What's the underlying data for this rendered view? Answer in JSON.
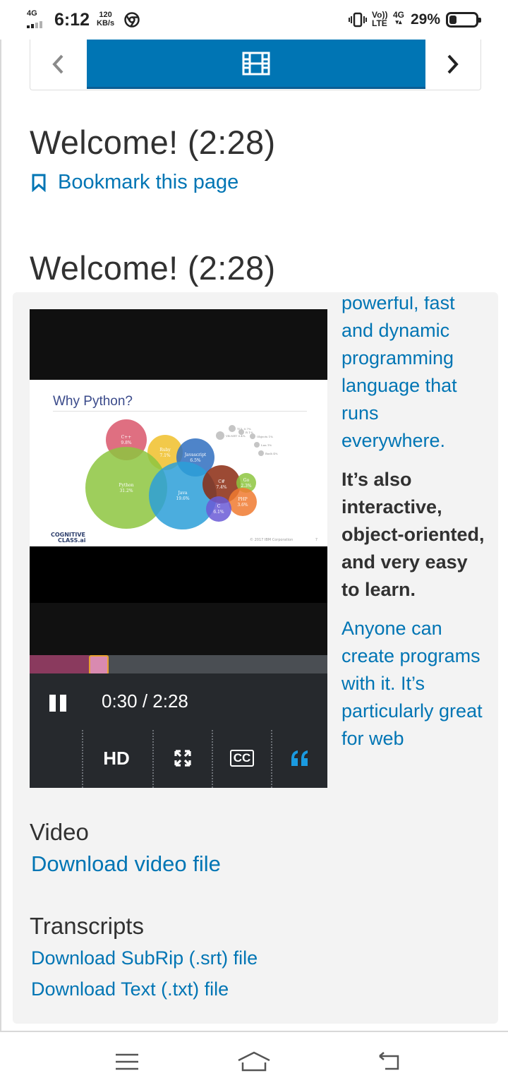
{
  "status_bar": {
    "network_badge": "4G",
    "time": "6:12",
    "speed_value": "120",
    "speed_unit": "KB/s",
    "volte_top": "Vo))",
    "volte_bottom": "LTE",
    "net_type": "4G",
    "battery_percent": "29%",
    "battery_level": 0.29
  },
  "sequence_nav": {
    "active_icon": "film-icon",
    "accent_color": "#0075b4"
  },
  "unit": {
    "header_title": "Welcome! (2:28)",
    "bookmark_label": "Bookmark this page",
    "video_title": "Welcome! (2:28)"
  },
  "video": {
    "slide_title": "Why Python?",
    "slide_logo_line1": "COGNITIVE",
    "slide_logo_line2": "CLASS.ai",
    "slide_copyright": "© 2017 IBM Corporation",
    "slide_page": "7",
    "bubbles": [
      {
        "label": "C++",
        "value": "9.8%",
        "color": "#d9566b"
      },
      {
        "label": "Ruby",
        "value": "7.1%",
        "color": "#f0c02a"
      },
      {
        "label": "Javascript",
        "value": "6.5%",
        "color": "#2f6fbf"
      },
      {
        "label": "Python",
        "value": "31.2%",
        "color": "#8dc63f"
      },
      {
        "label": "Java",
        "value": "19.6%",
        "color": "#2b9fd8"
      },
      {
        "label": "C#",
        "value": "7.4%",
        "color": "#8b2a10"
      },
      {
        "label": "Go",
        "value": "2.3%",
        "color": "#8dc63f"
      },
      {
        "label": "PHP",
        "value": "3.6%",
        "color": "#f07a30"
      },
      {
        "label": "C",
        "value": "6.1%",
        "color": "#6a5bd6"
      },
      {
        "label": "VB.NET",
        "value": "0.4%",
        "color": "#bbbbbb"
      },
      {
        "label": "TCL",
        "value": "0.7%",
        "color": "#bbbbbb"
      },
      {
        "label": "R",
        "value": "1%",
        "color": "#bbbbbb"
      },
      {
        "label": "Objects",
        "value": "1%",
        "color": "#bbbbbb"
      },
      {
        "label": "Lua",
        "value": "1%",
        "color": "#bbbbbb"
      },
      {
        "label": "Bash",
        "value": "4%",
        "color": "#bbbbbb"
      }
    ],
    "current_time": "0:30",
    "duration": "2:28",
    "time_display": "0:30 / 2:28",
    "progress_fraction": 0.2,
    "hd_label": "HD",
    "play_state": "pause-icon",
    "fullscreen_icon": "fullscreen-icon",
    "cc_label": "CC",
    "transcript_icon": "quote-icon"
  },
  "transcript": [
    {
      "text": "powerful, fast and dynamic programming language that runs everywhere.",
      "current": false
    },
    {
      "text": "It’s also interactive, object-oriented, and very easy to learn.",
      "current": true
    },
    {
      "text": "Anyone can create programs with it. It’s particularly great for web",
      "current": false
    }
  ],
  "downloads": {
    "video_heading": "Video",
    "video_link": "Download video file",
    "transcripts_heading": "Transcripts",
    "srt_link": "Download SubRip (.srt) file",
    "txt_link": "Download Text (.txt) file"
  },
  "nav_bar": {
    "menu_icon": "menu-icon",
    "home_icon": "home-icon",
    "back_icon": "back-icon"
  }
}
